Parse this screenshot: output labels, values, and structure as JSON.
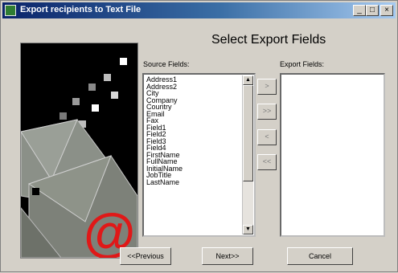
{
  "window": {
    "title": "Export recipients to Text File",
    "controls": {
      "minimize": "_",
      "maximize": "□",
      "close": "×"
    }
  },
  "heading": "Select Export Fields",
  "source_label": "Source Fields:",
  "export_label": "Export Fields:",
  "source_fields": [
    "Address1",
    "Address2",
    "City",
    "Company",
    "Country",
    "Email",
    "Fax",
    "Field1",
    "Field2",
    "Field3",
    "Field4",
    "FirstName",
    "FullName",
    "InitialName",
    "JobTitle",
    "LastName"
  ],
  "export_fields": [],
  "move_buttons": {
    "add": ">",
    "add_all": ">>",
    "remove": "<",
    "remove_all": "<<"
  },
  "scroll": {
    "up": "▲",
    "down": "▼"
  },
  "buttons": {
    "previous": "<<Previous",
    "next": "Next>>",
    "cancel": "Cancel"
  },
  "colors": {
    "title_start": "#0a246a",
    "title_end": "#a6caf0",
    "face": "#d4d0c8",
    "accent_red": "#e01818"
  },
  "icons": {
    "art": "envelope-at-icon"
  }
}
